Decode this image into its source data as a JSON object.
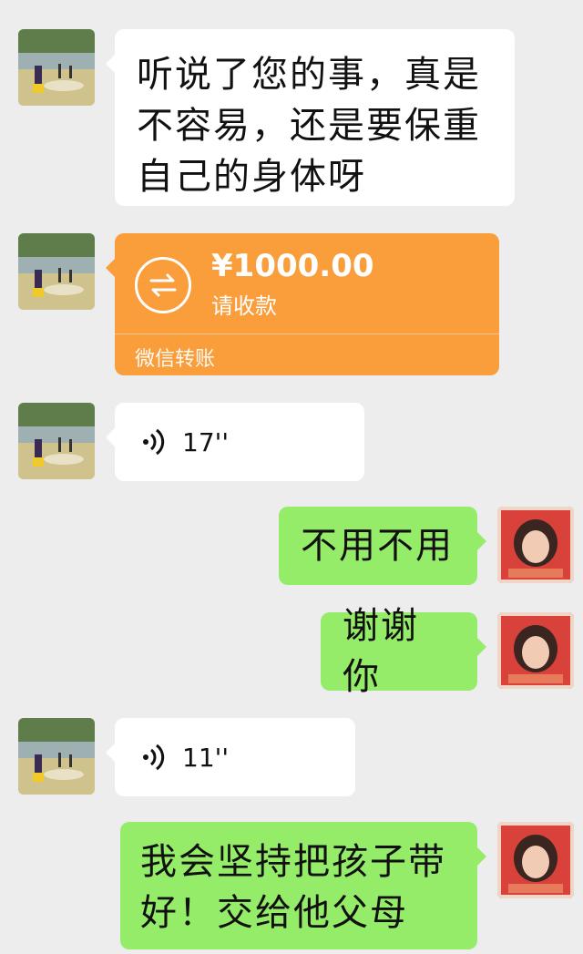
{
  "messages": [
    {
      "type": "text",
      "side": "left",
      "text": "听说了您的事，真是不容易，还是要保重自己的身体呀"
    },
    {
      "type": "transfer",
      "side": "left",
      "amount": "¥1000.00",
      "status": "请收款",
      "label": "微信转账"
    },
    {
      "type": "voice",
      "side": "left",
      "duration": "17''"
    },
    {
      "type": "text",
      "side": "right",
      "text": "不用不用"
    },
    {
      "type": "text",
      "side": "right",
      "text": "谢谢你"
    },
    {
      "type": "voice",
      "side": "left",
      "duration": "11''"
    },
    {
      "type": "text",
      "side": "right",
      "text": "我会坚持把孩子带好！交给他父母"
    }
  ],
  "colors": {
    "background": "#ededed",
    "bubble_incoming": "#ffffff",
    "bubble_outgoing": "#95ec69",
    "transfer": "#fa9d3b"
  },
  "icons": {
    "voice": "voice-wave-icon",
    "transfer": "transfer-arrows-icon",
    "avatar_left": "landscape-photo-avatar",
    "avatar_right": "portrait-photo-avatar"
  }
}
